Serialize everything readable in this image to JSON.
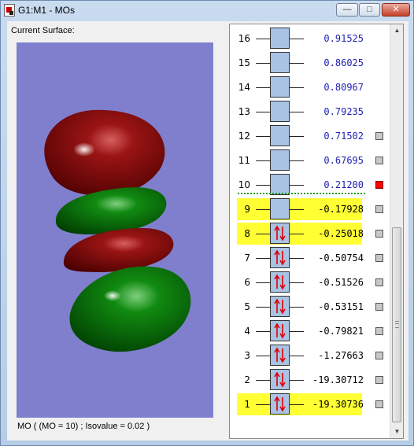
{
  "window": {
    "title": "G1:M1 - MOs",
    "controls": {
      "minimize": "—",
      "maximize": "□",
      "close": "✕"
    }
  },
  "surface_label": "Current Surface:",
  "status_text": "MO ( (MO = 10) ; Isovalue = 0.02 )",
  "colors": {
    "background": "#7f7fce",
    "lobe_red": "#8f0f0f",
    "lobe_green": "#0c7a0c",
    "highlight": "#ffff33",
    "energy_virtual": "#1f1fb2",
    "active_marker": "#ff0000"
  },
  "orbitals": [
    {
      "num": "16",
      "energy": "0.91525",
      "occupied": false,
      "highlight": false,
      "marker": "none"
    },
    {
      "num": "15",
      "energy": "0.86025",
      "occupied": false,
      "highlight": false,
      "marker": "none"
    },
    {
      "num": "14",
      "energy": "0.80967",
      "occupied": false,
      "highlight": false,
      "marker": "none"
    },
    {
      "num": "13",
      "energy": "0.79235",
      "occupied": false,
      "highlight": false,
      "marker": "none"
    },
    {
      "num": "12",
      "energy": "0.71502",
      "occupied": false,
      "highlight": false,
      "marker": "gray"
    },
    {
      "num": "11",
      "energy": "0.67695",
      "occupied": false,
      "highlight": false,
      "marker": "gray"
    },
    {
      "num": "10",
      "energy": "0.21200",
      "occupied": false,
      "highlight": false,
      "marker": "red"
    },
    {
      "num": "9",
      "energy": "-0.17928",
      "occupied": false,
      "highlight": true,
      "marker": "gray"
    },
    {
      "num": "8",
      "energy": "-0.25018",
      "occupied": true,
      "highlight": true,
      "marker": "gray"
    },
    {
      "num": "7",
      "energy": "-0.50754",
      "occupied": true,
      "highlight": false,
      "marker": "gray"
    },
    {
      "num": "6",
      "energy": "-0.51526",
      "occupied": true,
      "highlight": false,
      "marker": "gray"
    },
    {
      "num": "5",
      "energy": "-0.53151",
      "occupied": true,
      "highlight": false,
      "marker": "gray"
    },
    {
      "num": "4",
      "energy": "-0.79821",
      "occupied": true,
      "highlight": false,
      "marker": "gray"
    },
    {
      "num": "3",
      "energy": "-1.27663",
      "occupied": true,
      "highlight": false,
      "marker": "gray"
    },
    {
      "num": "2",
      "energy": "-19.30712",
      "occupied": true,
      "highlight": false,
      "marker": "gray"
    },
    {
      "num": "1",
      "energy": "-19.30736",
      "occupied": true,
      "highlight": true,
      "marker": "gray"
    }
  ],
  "icons": {
    "app": "gaussview-app-icon",
    "scroll_up": "scroll-up-arrow-icon",
    "scroll_down": "scroll-down-arrow-icon"
  }
}
